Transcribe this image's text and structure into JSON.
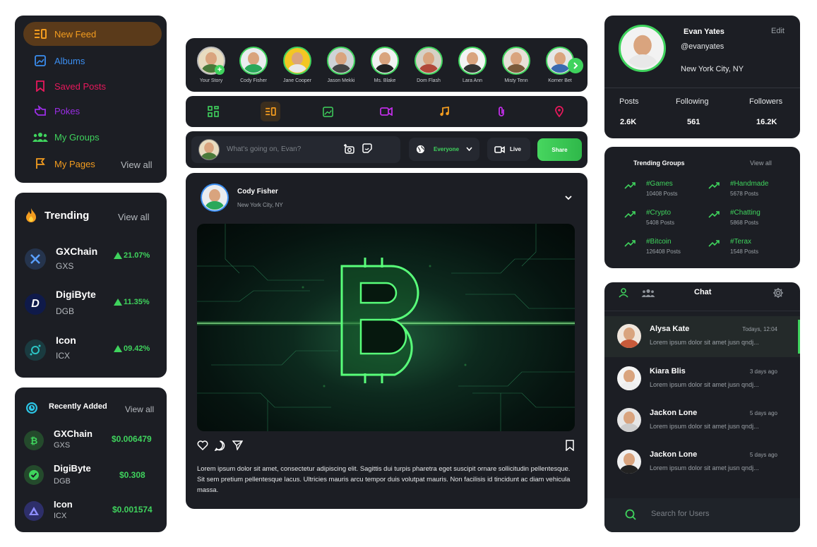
{
  "nav": {
    "items": [
      {
        "label": "New Feed",
        "color": "#f39c1f",
        "icon": "feed-icon",
        "active": true
      },
      {
        "label": "Albums",
        "color": "#3b8ef0",
        "icon": "image-icon"
      },
      {
        "label": "Saved Posts",
        "color": "#e8185c",
        "icon": "bookmark-icon"
      },
      {
        "label": "Pokes",
        "color": "#9b2ee6",
        "icon": "poke-hand-icon"
      },
      {
        "label": "My Groups",
        "color": "#3fd35d",
        "icon": "group-icon"
      },
      {
        "label": "My Pages",
        "color": "#f39c1f",
        "icon": "flag-icon"
      }
    ],
    "view_all": "View all"
  },
  "trending": {
    "title": "Trending",
    "view_all": "View all",
    "coins": [
      {
        "name": "GXChain",
        "symbol": "GXS",
        "change": "21.07%"
      },
      {
        "name": "DigiByte",
        "symbol": "DGB",
        "change": "11.35%"
      },
      {
        "name": "Icon",
        "symbol": "ICX",
        "change": "09.42%"
      }
    ]
  },
  "recent": {
    "title": "Recently Added",
    "view_all": "View all",
    "coins": [
      {
        "name": "GXChain",
        "symbol": "GXS",
        "price": "$0.006479"
      },
      {
        "name": "DigiByte",
        "symbol": "DGB",
        "price": "$0.308"
      },
      {
        "name": "Icon",
        "symbol": "ICX",
        "price": "$0.001574"
      }
    ]
  },
  "stories": [
    {
      "name": "Your Story"
    },
    {
      "name": "Cody Fisher"
    },
    {
      "name": "Jane Cooper"
    },
    {
      "name": "Jason Mekki"
    },
    {
      "name": "Ms. Blake"
    },
    {
      "name": "Dom Flash"
    },
    {
      "name": "Lara Ann"
    },
    {
      "name": "Misty Tenn"
    },
    {
      "name": "Korner Bet"
    }
  ],
  "composer": {
    "placeholder": "What's going on, Evan?",
    "audience": "Everyone",
    "live": "Live",
    "share": "Share"
  },
  "post": {
    "author": "Cody Fisher",
    "location": "New York City, NY",
    "body": "Lorem ipsum dolor sit amet, consectetur adipiscing elit. Sagittis dui turpis pharetra eget suscipit ornare sollicitudin pellentesque. Sit sem pretium pellentesque lacus. Ultricies mauris arcu tempor duis volutpat mauris. Non facilisis id tincidunt ac diam vehicula massa."
  },
  "profile": {
    "name": "Evan Yates",
    "handle": "@evanyates",
    "location": "New York City, NY",
    "edit": "Edit",
    "stats": [
      {
        "label": "Posts",
        "value": "2.6K"
      },
      {
        "label": "Following",
        "value": "561"
      },
      {
        "label": "Followers",
        "value": "16.2K"
      }
    ]
  },
  "groups": {
    "title": "Trending Groups",
    "view_all": "View all",
    "items": [
      {
        "tag": "#Games",
        "posts": "10408 Posts"
      },
      {
        "tag": "#Handmade",
        "posts": "5678 Posts"
      },
      {
        "tag": "#Crypto",
        "posts": "5408 Posts"
      },
      {
        "tag": "#Chatting",
        "posts": "5868 Posts"
      },
      {
        "tag": "#Bitcoin",
        "posts": "126408 Posts"
      },
      {
        "tag": "#Terax",
        "posts": "1548 Posts"
      }
    ]
  },
  "chat": {
    "title": "Chat",
    "search_placeholder": "Search for Users",
    "items": [
      {
        "name": "Alysa Kate",
        "time": "Todays, 12:04",
        "message": "Lorem ipsum dolor sit amet jusn qndj..."
      },
      {
        "name": "Kiara Blis",
        "time": "3 days ago",
        "message": "Lorem ipsum dolor sit amet jusn qndj..."
      },
      {
        "name": "Jackon Lone",
        "time": "5 days ago",
        "message": "Lorem ipsum dolor sit amet jusn qndj..."
      },
      {
        "name": "Jackon Lone",
        "time": "5 days ago",
        "message": "Lorem ipsum dolor sit amet jusn qndj..."
      }
    ]
  },
  "colors": {
    "accent": "#3fd35d",
    "card": "#1c1e24",
    "background": "#ffffff"
  }
}
